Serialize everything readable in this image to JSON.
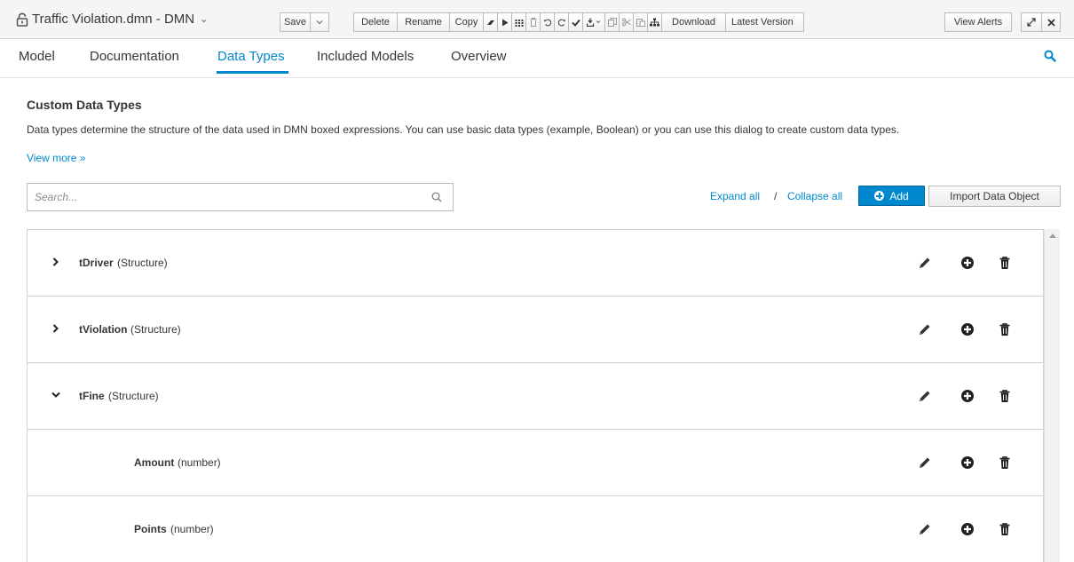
{
  "header": {
    "file_title": "Traffic Violation.dmn - DMN",
    "toolbar": {
      "save": "Save",
      "delete": "Delete",
      "rename": "Rename",
      "copy": "Copy",
      "download": "Download",
      "latest_version": "Latest Version",
      "view_alerts": "View Alerts"
    }
  },
  "tabs": [
    "Model",
    "Documentation",
    "Data Types",
    "Included Models",
    "Overview"
  ],
  "active_tab": "Data Types",
  "content": {
    "title": "Custom Data Types",
    "description": "Data types determine the structure of the data used in DMN boxed expressions. You can use basic data types (example, Boolean) or you can use this dialog to create custom data types.",
    "view_more": "View more »",
    "search_placeholder": "Search...",
    "expand_all": "Expand all",
    "separator": "/",
    "collapse_all": "Collapse all",
    "add_button": "Add",
    "import_button": "Import Data Object"
  },
  "data_types": [
    {
      "name": "tDriver",
      "type": "(Structure)",
      "expanded": false,
      "level": 0
    },
    {
      "name": "tViolation",
      "type": "(Structure)",
      "expanded": false,
      "level": 0
    },
    {
      "name": "tFine",
      "type": "(Structure)",
      "expanded": true,
      "level": 0
    },
    {
      "name": "Amount",
      "type": "(number)",
      "level": 1
    },
    {
      "name": "Points",
      "type": "(number)",
      "level": 1
    }
  ],
  "colors": {
    "accent": "#0088ce",
    "text": "#363636",
    "border": "#d1d1d1"
  },
  "icons": {
    "lock": "lock-icon",
    "search": "search-icon",
    "edit": "pencil-icon",
    "add": "plus-circle-icon",
    "delete": "trash-icon",
    "collapsed": "chevron-right-icon",
    "expanded": "chevron-down-icon"
  }
}
